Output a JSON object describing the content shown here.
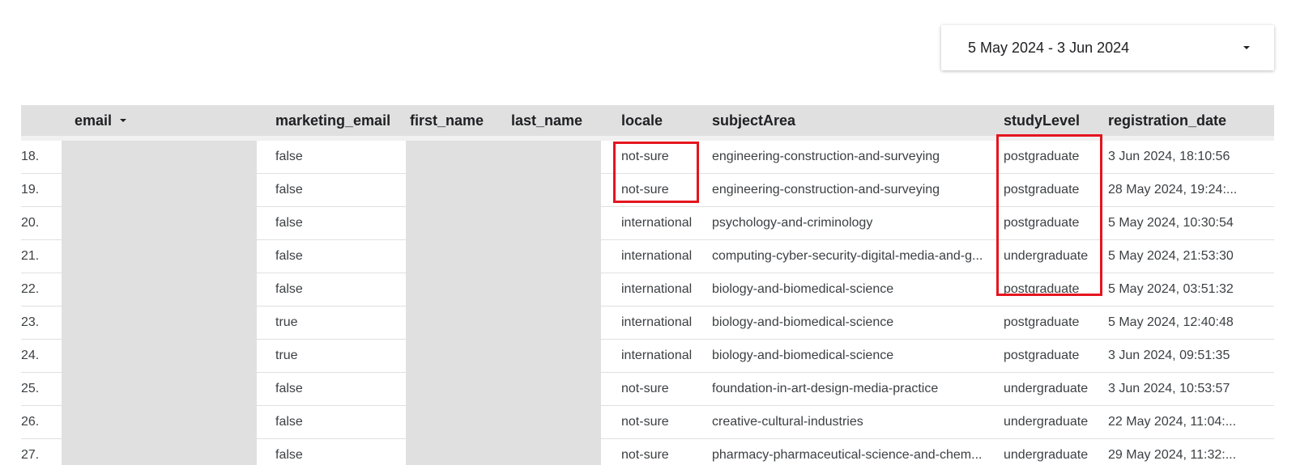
{
  "date_range": {
    "label": "5 May 2024 - 3 Jun 2024",
    "dropdown_icon": "caret-down-icon"
  },
  "table": {
    "columns": {
      "email": "email",
      "marketing_email": "marketing_email",
      "first_name": "first_name",
      "last_name": "last_name",
      "locale": "locale",
      "subjectArea": "subjectArea",
      "studyLevel": "studyLevel",
      "registration_date": "registration_date"
    },
    "sort_icon": "sort-caret-down-icon",
    "rows": [
      {
        "num": "18.",
        "marketing_email": "false",
        "locale": "not-sure",
        "subjectArea": "engineering-construction-and-surveying",
        "studyLevel": "postgraduate",
        "registration_date": "3 Jun 2024, 18:10:56"
      },
      {
        "num": "19.",
        "marketing_email": "false",
        "locale": "not-sure",
        "subjectArea": "engineering-construction-and-surveying",
        "studyLevel": "postgraduate",
        "registration_date": "28 May 2024, 19:24:..."
      },
      {
        "num": "20.",
        "marketing_email": "false",
        "locale": "international",
        "subjectArea": "psychology-and-criminology",
        "studyLevel": "postgraduate",
        "registration_date": "5 May 2024, 10:30:54"
      },
      {
        "num": "21.",
        "marketing_email": "false",
        "locale": "international",
        "subjectArea": "computing-cyber-security-digital-media-and-g...",
        "studyLevel": "undergraduate",
        "registration_date": "5 May 2024, 21:53:30"
      },
      {
        "num": "22.",
        "marketing_email": "false",
        "locale": "international",
        "subjectArea": "biology-and-biomedical-science",
        "studyLevel": "postgraduate",
        "registration_date": "5 May 2024, 03:51:32"
      },
      {
        "num": "23.",
        "marketing_email": "true",
        "locale": "international",
        "subjectArea": "biology-and-biomedical-science",
        "studyLevel": "postgraduate",
        "registration_date": "5 May 2024, 12:40:48"
      },
      {
        "num": "24.",
        "marketing_email": "true",
        "locale": "international",
        "subjectArea": "biology-and-biomedical-science",
        "studyLevel": "postgraduate",
        "registration_date": "3 Jun 2024, 09:51:35"
      },
      {
        "num": "25.",
        "marketing_email": "false",
        "locale": "not-sure",
        "subjectArea": "foundation-in-art-design-media-practice",
        "studyLevel": "undergraduate",
        "registration_date": "3 Jun 2024, 10:53:57"
      },
      {
        "num": "26.",
        "marketing_email": "false",
        "locale": "not-sure",
        "subjectArea": "creative-cultural-industries",
        "studyLevel": "undergraduate",
        "registration_date": "22 May 2024, 11:04:..."
      },
      {
        "num": "27.",
        "marketing_email": "false",
        "locale": "not-sure",
        "subjectArea": "pharmacy-pharmaceutical-science-and-chem...",
        "studyLevel": "undergraduate",
        "registration_date": "29 May 2024, 11:32:..."
      }
    ]
  },
  "highlight_color": "#e5151f"
}
